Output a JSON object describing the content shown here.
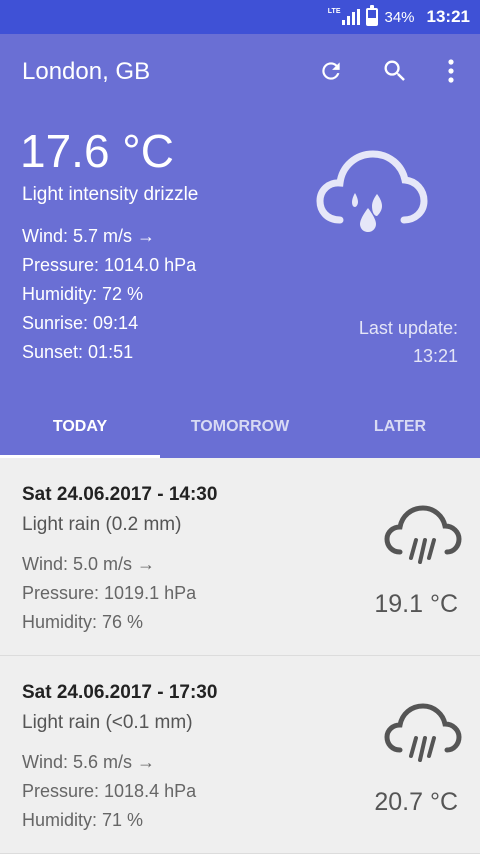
{
  "status_bar": {
    "network": "LTE",
    "battery": "34%",
    "time": "13:21"
  },
  "toolbar": {
    "city": "London, GB",
    "refresh_icon": "refresh-icon",
    "search_icon": "search-icon",
    "menu_icon": "more-vert-icon"
  },
  "current": {
    "temperature": "17.6 °C",
    "description": "Light intensity drizzle",
    "wind": "Wind: 5.7 m/s →",
    "pressure": "Pressure: 1014.0 hPa",
    "humidity": "Humidity: 72 %",
    "sunrise": "Sunrise: 09:14",
    "sunset": "Sunset: 01:51",
    "last_update_label": "Last update:",
    "last_update_time": "13:21",
    "icon": "drizzle-cloud-icon"
  },
  "tabs": [
    {
      "label": "TODAY",
      "active": true
    },
    {
      "label": "TOMORROW",
      "active": false
    },
    {
      "label": "LATER",
      "active": false
    }
  ],
  "forecast": [
    {
      "datetime": "Sat 24.06.2017 - 14:30",
      "description": "Light rain (0.2 mm)",
      "wind": "Wind: 5.0 m/s →",
      "pressure": "Pressure: 1019.1 hPa",
      "humidity": "Humidity: 76 %",
      "temperature": "19.1 °C",
      "icon": "rain-cloud-icon"
    },
    {
      "datetime": "Sat 24.06.2017 - 17:30",
      "description": "Light rain (<0.1 mm)",
      "wind": "Wind: 5.6 m/s →",
      "pressure": "Pressure: 1018.4 hPa",
      "humidity": "Humidity: 71 %",
      "temperature": "20.7 °C",
      "icon": "rain-cloud-icon"
    }
  ]
}
